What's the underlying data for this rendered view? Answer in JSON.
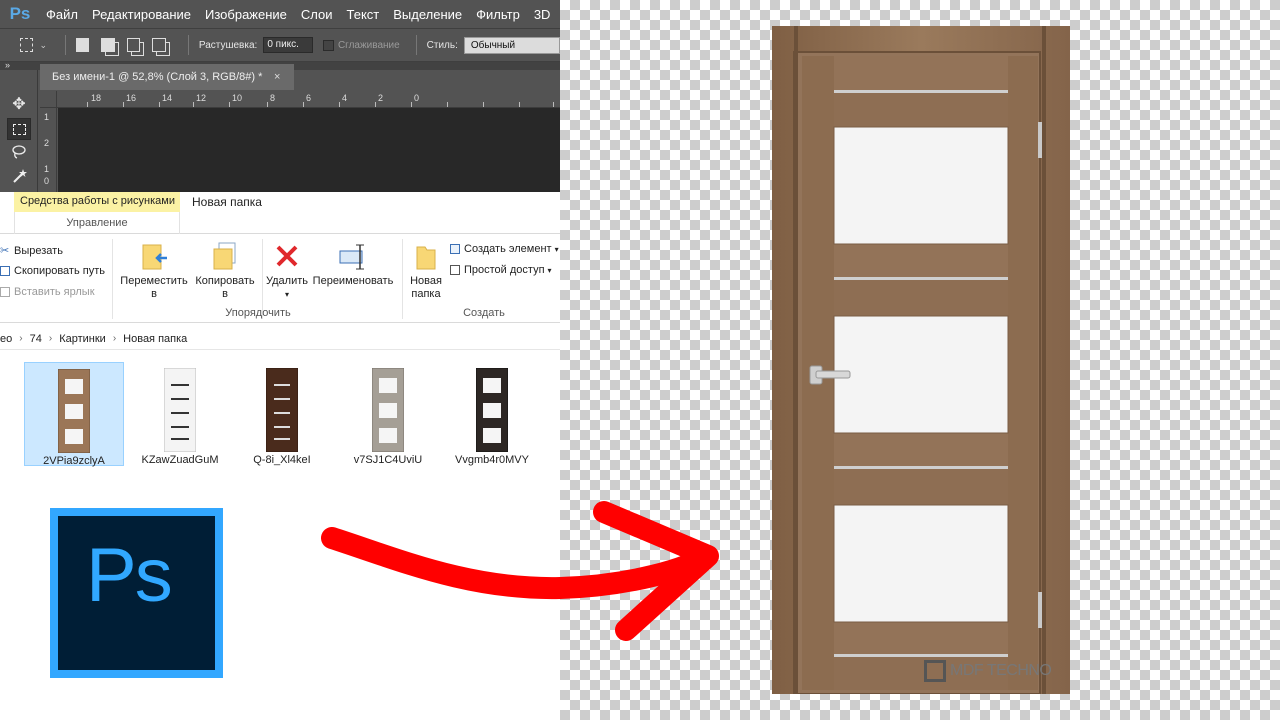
{
  "photoshop": {
    "menu": [
      "Файл",
      "Редактирование",
      "Изображение",
      "Слои",
      "Текст",
      "Выделение",
      "Фильтр",
      "3D"
    ],
    "logo": "Ps",
    "options": {
      "feather_label": "Растушевка:",
      "feather_value": "0 пикс.",
      "antialias_label": "Сглаживание",
      "style_label": "Стиль:",
      "style_value": "Обычный"
    },
    "doc_tab": "Без имени-1 @ 52,8% (Слой 3, RGB/8#) *",
    "doc_close": "×",
    "ruler_numbers": [
      "18",
      "16",
      "14",
      "12",
      "10",
      "8",
      "6",
      "4",
      "2",
      "0"
    ],
    "vruler_numbers": [
      "1",
      "2",
      "1",
      "0"
    ]
  },
  "explorer": {
    "contextual_tab": "Средства работы с рисунками",
    "contextual_group": "Управление",
    "window_title": "Новая папка",
    "clipboard": {
      "cut": "Вырезать",
      "copy_path": "Скопировать путь",
      "paste_shortcut": "Вставить ярлык"
    },
    "organize": {
      "move_to": "Переместить",
      "copy_to": "Копировать",
      "sub_to": "в",
      "delete": "Удалить",
      "rename": "Переименовать",
      "label": "Упорядочить"
    },
    "new": {
      "new_folder_1": "Новая",
      "new_folder_2": "папка",
      "new_item": "Создать элемент",
      "easy_access": "Простой доступ",
      "label": "Создать"
    },
    "breadcrumb": [
      "eo",
      "74",
      "Картинки",
      "Новая папка"
    ],
    "files": [
      {
        "name": "2VPia9zclyA",
        "selected": true
      },
      {
        "name": "KZawZuadGuM",
        "selected": false
      },
      {
        "name": "Q-8i_Xl4keI",
        "selected": false
      },
      {
        "name": "v7SJ1C4UviU",
        "selected": false
      },
      {
        "name": "Vvgmb4r0MVY",
        "selected": false
      }
    ]
  },
  "app_icon": {
    "text": "Ps",
    "border_color": "#32a7ff",
    "bg_color": "#001e36"
  },
  "watermark": "MDF TECHNO",
  "colors": {
    "arrow": "#ff0000",
    "door_wood": "#8b6c4f"
  }
}
